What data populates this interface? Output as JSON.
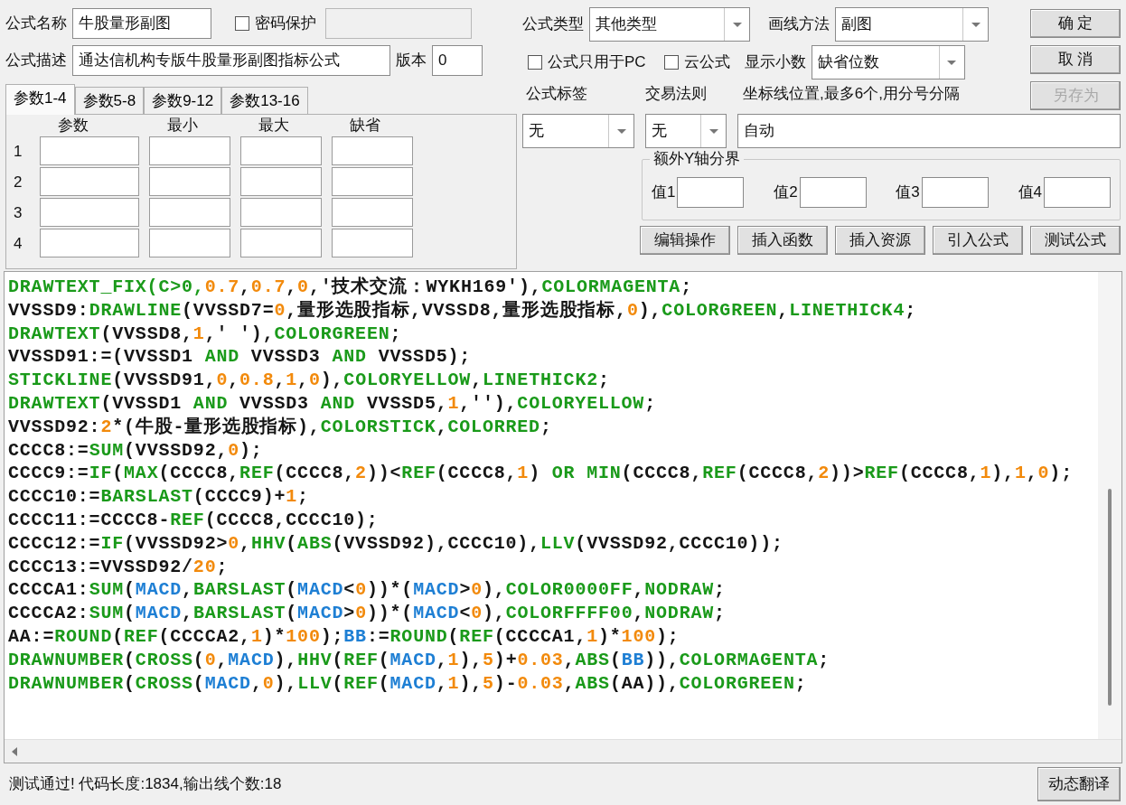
{
  "formula_name": {
    "label": "公式名称",
    "value": "牛股量形副图"
  },
  "password": {
    "label": "密码保护",
    "checked": false
  },
  "password_field": {
    "disabled": true
  },
  "description": {
    "label": "公式描述",
    "value": "通达信机构专版牛股量形副图指标公式"
  },
  "version": {
    "label": "版本",
    "value": "0"
  },
  "param_tabs": [
    {
      "label": "参数1-4",
      "selected": true
    },
    {
      "label": "参数5-8",
      "selected": false
    },
    {
      "label": "参数9-12",
      "selected": false
    },
    {
      "label": "参数13-16",
      "selected": false
    }
  ],
  "param_columns": [
    "参数",
    "最小",
    "最大",
    "缺省"
  ],
  "param_rows": [
    "1",
    "2",
    "3",
    "4"
  ],
  "formula_type": {
    "label": "公式类型",
    "value": "其他类型"
  },
  "draw_method": {
    "label": "画线方法",
    "value": "副图"
  },
  "pc_only": {
    "label": "公式只用于PC",
    "checked": false
  },
  "cloud": {
    "label": "云公式",
    "checked": false
  },
  "decimals": {
    "label": "显示小数",
    "value": "缺省位数"
  },
  "side_buttons": [
    {
      "label": "确 定",
      "disabled": false
    },
    {
      "label": "取 消",
      "disabled": false
    },
    {
      "label": "另存为",
      "disabled": true
    }
  ],
  "tag": {
    "label": "公式标签",
    "value": "无"
  },
  "trade_rule": {
    "label": "交易法则",
    "value": "无"
  },
  "axis_lines": {
    "label": "坐标线位置,最多6个,用分号分隔",
    "value": "自动"
  },
  "extra_y": {
    "title": "额外Y轴分界",
    "fields": [
      "值1",
      "值2",
      "值3",
      "值4"
    ]
  },
  "tool_buttons": [
    "编辑操作",
    "插入函数",
    "插入资源",
    "引入公式",
    "测试公式"
  ],
  "code_lines": [
    {
      "tokens": [
        {
          "kind": "fn",
          "text": "DRAWTEXT_FIX(C>0,"
        },
        {
          "kind": "num",
          "text": "0.7"
        },
        {
          "kind": "txt",
          "text": ","
        },
        {
          "kind": "num",
          "text": "0.7"
        },
        {
          "kind": "txt",
          "text": ","
        },
        {
          "kind": "num",
          "text": "0"
        },
        {
          "kind": "txt",
          "text": ",'技术交流：WYKH169'),"
        },
        {
          "kind": "fn",
          "text": "COLORMAGENTA"
        },
        {
          "kind": "txt",
          "text": ";"
        }
      ]
    },
    {
      "tokens": [
        {
          "kind": "txt",
          "text": "VVSSD9:"
        },
        {
          "kind": "fn",
          "text": "DRAWLINE"
        },
        {
          "kind": "txt",
          "text": "(VVSSD7="
        },
        {
          "kind": "num",
          "text": "0"
        },
        {
          "kind": "txt",
          "text": ",量形选股指标,VVSSD8,量形选股指标,"
        },
        {
          "kind": "num",
          "text": "0"
        },
        {
          "kind": "txt",
          "text": "),"
        },
        {
          "kind": "fn",
          "text": "COLORGREEN"
        },
        {
          "kind": "txt",
          "text": ","
        },
        {
          "kind": "fn",
          "text": "LINETHICK4"
        },
        {
          "kind": "txt",
          "text": ";"
        }
      ]
    },
    {
      "tokens": [
        {
          "kind": "fn",
          "text": "DRAWTEXT"
        },
        {
          "kind": "txt",
          "text": "(VVSSD8,"
        },
        {
          "kind": "num",
          "text": "1"
        },
        {
          "kind": "txt",
          "text": ",' '),"
        },
        {
          "kind": "fn",
          "text": "COLORGREEN"
        },
        {
          "kind": "txt",
          "text": ";"
        }
      ]
    },
    {
      "tokens": [
        {
          "kind": "txt",
          "text": "VVSSD91:=(VVSSD1 "
        },
        {
          "kind": "fn",
          "text": "AND"
        },
        {
          "kind": "txt",
          "text": " VVSSD3 "
        },
        {
          "kind": "fn",
          "text": "AND"
        },
        {
          "kind": "txt",
          "text": " VVSSD5);"
        }
      ]
    },
    {
      "tokens": [
        {
          "kind": "fn",
          "text": "STICKLINE"
        },
        {
          "kind": "txt",
          "text": "(VVSSD91,"
        },
        {
          "kind": "num",
          "text": "0"
        },
        {
          "kind": "txt",
          "text": ","
        },
        {
          "kind": "num",
          "text": "0.8"
        },
        {
          "kind": "txt",
          "text": ","
        },
        {
          "kind": "num",
          "text": "1"
        },
        {
          "kind": "txt",
          "text": ","
        },
        {
          "kind": "num",
          "text": "0"
        },
        {
          "kind": "txt",
          "text": "),"
        },
        {
          "kind": "fn",
          "text": "COLORYELLOW"
        },
        {
          "kind": "txt",
          "text": ","
        },
        {
          "kind": "fn",
          "text": "LINETHICK2"
        },
        {
          "kind": "txt",
          "text": ";"
        }
      ]
    },
    {
      "tokens": [
        {
          "kind": "fn",
          "text": "DRAWTEXT"
        },
        {
          "kind": "txt",
          "text": "(VVSSD1 "
        },
        {
          "kind": "fn",
          "text": "AND"
        },
        {
          "kind": "txt",
          "text": " VVSSD3 "
        },
        {
          "kind": "fn",
          "text": "AND"
        },
        {
          "kind": "txt",
          "text": " VVSSD5,"
        },
        {
          "kind": "num",
          "text": "1"
        },
        {
          "kind": "txt",
          "text": ",''),"
        },
        {
          "kind": "fn",
          "text": "COLORYELLOW"
        },
        {
          "kind": "txt",
          "text": ";"
        }
      ]
    },
    {
      "tokens": [
        {
          "kind": "txt",
          "text": "VVSSD92:"
        },
        {
          "kind": "num",
          "text": "2"
        },
        {
          "kind": "txt",
          "text": "*(牛股-量形选股指标),"
        },
        {
          "kind": "fn",
          "text": "COLORSTICK"
        },
        {
          "kind": "txt",
          "text": ","
        },
        {
          "kind": "fn",
          "text": "COLORRED"
        },
        {
          "kind": "txt",
          "text": ";"
        }
      ]
    },
    {
      "tokens": [
        {
          "kind": "txt",
          "text": "CCCC8:="
        },
        {
          "kind": "fn",
          "text": "SUM"
        },
        {
          "kind": "txt",
          "text": "(VVSSD92,"
        },
        {
          "kind": "num",
          "text": "0"
        },
        {
          "kind": "txt",
          "text": ");"
        }
      ]
    },
    {
      "tokens": [
        {
          "kind": "txt",
          "text": "CCCC9:="
        },
        {
          "kind": "fn",
          "text": "IF"
        },
        {
          "kind": "txt",
          "text": "("
        },
        {
          "kind": "fn",
          "text": "MAX"
        },
        {
          "kind": "txt",
          "text": "(CCCC8,"
        },
        {
          "kind": "fn",
          "text": "REF"
        },
        {
          "kind": "txt",
          "text": "(CCCC8,"
        },
        {
          "kind": "num",
          "text": "2"
        },
        {
          "kind": "txt",
          "text": "))<"
        },
        {
          "kind": "fn",
          "text": "REF"
        },
        {
          "kind": "txt",
          "text": "(CCCC8,"
        },
        {
          "kind": "num",
          "text": "1"
        },
        {
          "kind": "txt",
          "text": ") "
        },
        {
          "kind": "fn",
          "text": "OR MIN"
        },
        {
          "kind": "txt",
          "text": "(CCCC8,"
        },
        {
          "kind": "fn",
          "text": "REF"
        },
        {
          "kind": "txt",
          "text": "(CCCC8,"
        },
        {
          "kind": "num",
          "text": "2"
        },
        {
          "kind": "txt",
          "text": "))>"
        },
        {
          "kind": "fn",
          "text": "REF"
        },
        {
          "kind": "txt",
          "text": "(CCCC8,"
        },
        {
          "kind": "num",
          "text": "1"
        },
        {
          "kind": "txt",
          "text": "),"
        },
        {
          "kind": "num",
          "text": "1"
        },
        {
          "kind": "txt",
          "text": ","
        },
        {
          "kind": "num",
          "text": "0"
        },
        {
          "kind": "txt",
          "text": ");"
        }
      ]
    },
    {
      "tokens": [
        {
          "kind": "txt",
          "text": "CCCC10:="
        },
        {
          "kind": "fn",
          "text": "BARSLAST"
        },
        {
          "kind": "txt",
          "text": "(CCCC9)+"
        },
        {
          "kind": "num",
          "text": "1"
        },
        {
          "kind": "txt",
          "text": ";"
        }
      ]
    },
    {
      "tokens": [
        {
          "kind": "txt",
          "text": "CCCC11:=CCCC8-"
        },
        {
          "kind": "fn",
          "text": "REF"
        },
        {
          "kind": "txt",
          "text": "(CCCC8,CCCC10);"
        }
      ]
    },
    {
      "tokens": [
        {
          "kind": "txt",
          "text": "CCCC12:="
        },
        {
          "kind": "fn",
          "text": "IF"
        },
        {
          "kind": "txt",
          "text": "(VVSSD92>"
        },
        {
          "kind": "num",
          "text": "0"
        },
        {
          "kind": "txt",
          "text": ","
        },
        {
          "kind": "fn",
          "text": "HHV"
        },
        {
          "kind": "txt",
          "text": "("
        },
        {
          "kind": "fn",
          "text": "ABS"
        },
        {
          "kind": "txt",
          "text": "(VVSSD92),CCCC10),"
        },
        {
          "kind": "fn",
          "text": "LLV"
        },
        {
          "kind": "txt",
          "text": "(VVSSD92,CCCC10));"
        }
      ]
    },
    {
      "tokens": [
        {
          "kind": "txt",
          "text": "CCCC13:=VVSSD92/"
        },
        {
          "kind": "num",
          "text": "20"
        },
        {
          "kind": "txt",
          "text": ";"
        }
      ]
    },
    {
      "tokens": [
        {
          "kind": "txt",
          "text": "CCCCA1:"
        },
        {
          "kind": "fn",
          "text": "SUM"
        },
        {
          "kind": "txt",
          "text": "("
        },
        {
          "kind": "var",
          "text": "MACD"
        },
        {
          "kind": "txt",
          "text": ","
        },
        {
          "kind": "fn",
          "text": "BARSLAST"
        },
        {
          "kind": "txt",
          "text": "("
        },
        {
          "kind": "var",
          "text": "MACD"
        },
        {
          "kind": "txt",
          "text": "<"
        },
        {
          "kind": "num",
          "text": "0"
        },
        {
          "kind": "txt",
          "text": "))*("
        },
        {
          "kind": "var",
          "text": "MACD"
        },
        {
          "kind": "txt",
          "text": ">"
        },
        {
          "kind": "num",
          "text": "0"
        },
        {
          "kind": "txt",
          "text": "),"
        },
        {
          "kind": "fn",
          "text": "COLOR0000FF"
        },
        {
          "kind": "txt",
          "text": ","
        },
        {
          "kind": "fn",
          "text": "NODRAW"
        },
        {
          "kind": "txt",
          "text": ";"
        }
      ]
    },
    {
      "tokens": [
        {
          "kind": "txt",
          "text": "CCCCA2:"
        },
        {
          "kind": "fn",
          "text": "SUM"
        },
        {
          "kind": "txt",
          "text": "("
        },
        {
          "kind": "var",
          "text": "MACD"
        },
        {
          "kind": "txt",
          "text": ","
        },
        {
          "kind": "fn",
          "text": "BARSLAST"
        },
        {
          "kind": "txt",
          "text": "("
        },
        {
          "kind": "var",
          "text": "MACD"
        },
        {
          "kind": "txt",
          "text": ">"
        },
        {
          "kind": "num",
          "text": "0"
        },
        {
          "kind": "txt",
          "text": "))*("
        },
        {
          "kind": "var",
          "text": "MACD"
        },
        {
          "kind": "txt",
          "text": "<"
        },
        {
          "kind": "num",
          "text": "0"
        },
        {
          "kind": "txt",
          "text": "),"
        },
        {
          "kind": "fn",
          "text": "COLORFFFF00"
        },
        {
          "kind": "txt",
          "text": ","
        },
        {
          "kind": "fn",
          "text": "NODRAW"
        },
        {
          "kind": "txt",
          "text": ";"
        }
      ]
    },
    {
      "tokens": [
        {
          "kind": "txt",
          "text": "AA:="
        },
        {
          "kind": "fn",
          "text": "ROUND"
        },
        {
          "kind": "txt",
          "text": "("
        },
        {
          "kind": "fn",
          "text": "REF"
        },
        {
          "kind": "txt",
          "text": "(CCCCA2,"
        },
        {
          "kind": "num",
          "text": "1"
        },
        {
          "kind": "txt",
          "text": ")*"
        },
        {
          "kind": "num",
          "text": "100"
        },
        {
          "kind": "txt",
          "text": ");"
        },
        {
          "kind": "var",
          "text": "BB"
        },
        {
          "kind": "txt",
          "text": ":="
        },
        {
          "kind": "fn",
          "text": "ROUND"
        },
        {
          "kind": "txt",
          "text": "("
        },
        {
          "kind": "fn",
          "text": "REF"
        },
        {
          "kind": "txt",
          "text": "(CCCCA1,"
        },
        {
          "kind": "num",
          "text": "1"
        },
        {
          "kind": "txt",
          "text": ")*"
        },
        {
          "kind": "num",
          "text": "100"
        },
        {
          "kind": "txt",
          "text": ");"
        }
      ]
    },
    {
      "tokens": [
        {
          "kind": "fn",
          "text": "DRAWNUMBER"
        },
        {
          "kind": "txt",
          "text": "("
        },
        {
          "kind": "fn",
          "text": "CROSS"
        },
        {
          "kind": "txt",
          "text": "("
        },
        {
          "kind": "num",
          "text": "0"
        },
        {
          "kind": "txt",
          "text": ","
        },
        {
          "kind": "var",
          "text": "MACD"
        },
        {
          "kind": "txt",
          "text": "),"
        },
        {
          "kind": "fn",
          "text": "HHV"
        },
        {
          "kind": "txt",
          "text": "("
        },
        {
          "kind": "fn",
          "text": "REF"
        },
        {
          "kind": "txt",
          "text": "("
        },
        {
          "kind": "var",
          "text": "MACD"
        },
        {
          "kind": "txt",
          "text": ","
        },
        {
          "kind": "num",
          "text": "1"
        },
        {
          "kind": "txt",
          "text": "),"
        },
        {
          "kind": "num",
          "text": "5"
        },
        {
          "kind": "txt",
          "text": ")+"
        },
        {
          "kind": "num",
          "text": "0.03"
        },
        {
          "kind": "txt",
          "text": ","
        },
        {
          "kind": "fn",
          "text": "ABS"
        },
        {
          "kind": "txt",
          "text": "("
        },
        {
          "kind": "var",
          "text": "BB"
        },
        {
          "kind": "txt",
          "text": ")),"
        },
        {
          "kind": "fn",
          "text": "COLORMAGENTA"
        },
        {
          "kind": "txt",
          "text": ";"
        }
      ]
    },
    {
      "tokens": [
        {
          "kind": "fn",
          "text": "DRAWNUMBER"
        },
        {
          "kind": "txt",
          "text": "("
        },
        {
          "kind": "fn",
          "text": "CROSS"
        },
        {
          "kind": "txt",
          "text": "("
        },
        {
          "kind": "var",
          "text": "MACD"
        },
        {
          "kind": "txt",
          "text": ","
        },
        {
          "kind": "num",
          "text": "0"
        },
        {
          "kind": "txt",
          "text": "),"
        },
        {
          "kind": "fn",
          "text": "LLV"
        },
        {
          "kind": "txt",
          "text": "("
        },
        {
          "kind": "fn",
          "text": "REF"
        },
        {
          "kind": "txt",
          "text": "("
        },
        {
          "kind": "var",
          "text": "MACD"
        },
        {
          "kind": "txt",
          "text": ","
        },
        {
          "kind": "num",
          "text": "1"
        },
        {
          "kind": "txt",
          "text": "),"
        },
        {
          "kind": "num",
          "text": "5"
        },
        {
          "kind": "txt",
          "text": ")-"
        },
        {
          "kind": "num",
          "text": "0.03"
        },
        {
          "kind": "txt",
          "text": ","
        },
        {
          "kind": "fn",
          "text": "ABS"
        },
        {
          "kind": "txt",
          "text": "(AA)),"
        },
        {
          "kind": "fn",
          "text": "COLORGREEN"
        },
        {
          "kind": "txt",
          "text": ";"
        }
      ]
    }
  ],
  "status": "测试通过! 代码长度:1834,输出线个数:18",
  "translate_button": "动态翻译"
}
